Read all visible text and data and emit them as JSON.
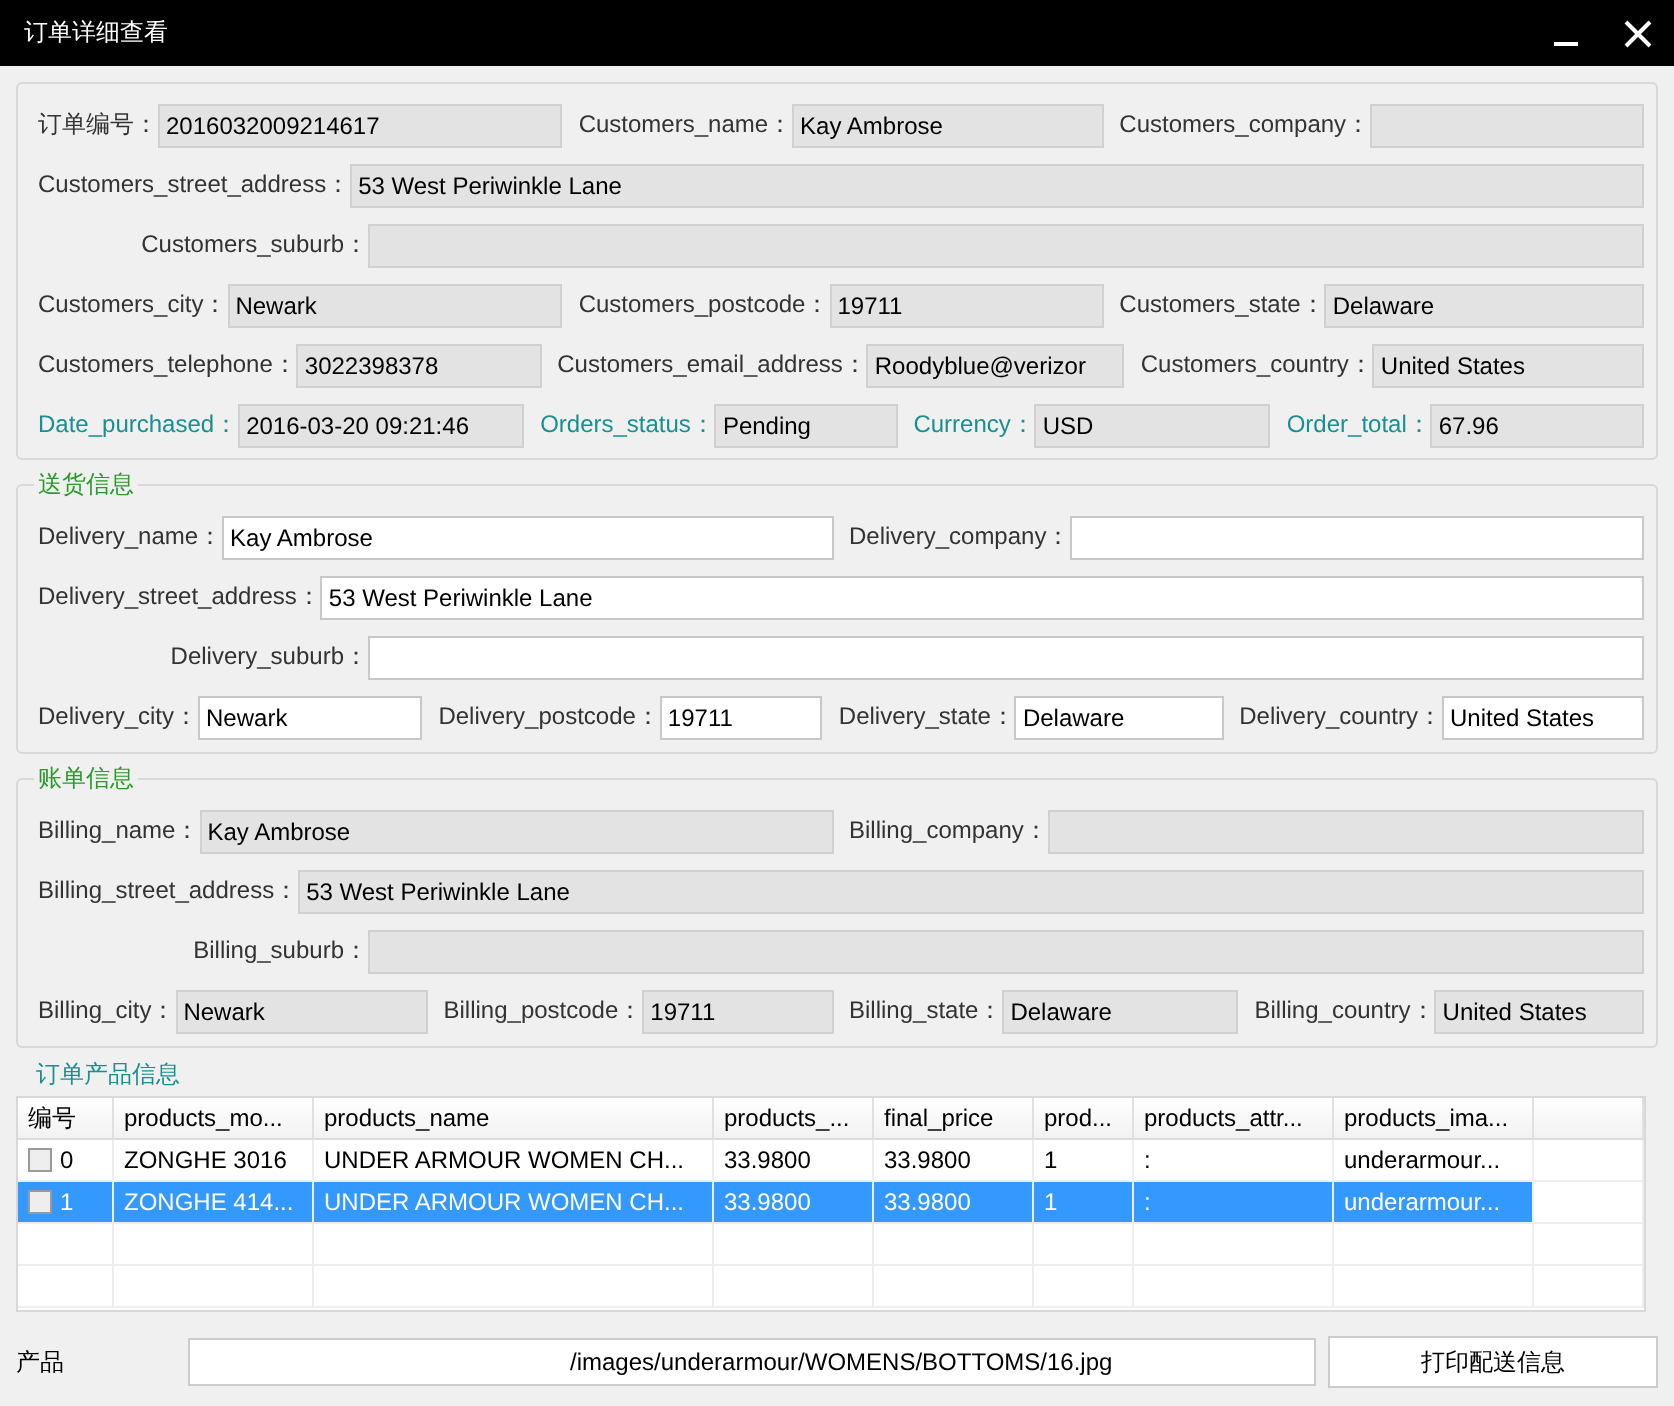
{
  "window": {
    "title": "订单详细查看"
  },
  "groups": [
    {
      "readonly": true,
      "rows": [
        {
          "fields": [
            {
              "label": "订单编号：",
              "value": "2016032009214617",
              "highlight": false
            },
            {
              "label": "Customers_name：",
              "value": "Kay Ambrose",
              "highlight": false
            },
            {
              "label": "Customers_company：",
              "highlight": false
            }
          ]
        },
        {
          "fields": [
            {
              "label": "Customers_street_address：",
              "value": "53 West Periwinkle Lane",
              "highlight": false
            }
          ]
        },
        {
          "fields": [
            {
              "label": "Customers_suburb：",
              "highlight": false
            }
          ]
        },
        {
          "fields": [
            {
              "label": "Customers_city：",
              "value": "Newark",
              "highlight": false
            },
            {
              "label": "Customers_postcode：",
              "value": "19711",
              "highlight": false
            },
            {
              "label": "Customers_state：",
              "value": "Delaware",
              "highlight": false
            }
          ]
        },
        {
          "fields": [
            {
              "label": "Customers_telephone：",
              "value": "3022398378",
              "highlight": false
            },
            {
              "label": "Customers_email_address：",
              "value": "Roodyblue@verizor",
              "highlight": false
            },
            {
              "label": "Customers_country：",
              "value": "United States",
              "highlight": false
            }
          ]
        },
        {
          "fields": [
            {
              "label": "Date_purchased：",
              "value": "2016-03-20 09:21:46",
              "highlight": true
            },
            {
              "label": "Orders_status：",
              "value": "Pending",
              "highlight": true
            },
            {
              "label": "Currency：",
              "value": "USD",
              "highlight": true
            },
            {
              "label": "Order_total：",
              "value": "67.96",
              "highlight": true
            }
          ]
        }
      ]
    },
    {
      "title": "送货信息",
      "readonly": false,
      "rows": [
        {
          "fields": [
            {
              "label": "Delivery_name：",
              "value": "Kay Ambrose",
              "highlight": false
            },
            {
              "label": "Delivery_company：",
              "highlight": false
            }
          ]
        },
        {
          "fields": [
            {
              "label": "Delivery_street_address：",
              "value": "53 West Periwinkle Lane",
              "highlight": false
            }
          ]
        },
        {
          "fields": [
            {
              "label": "Delivery_suburb：",
              "highlight": false
            }
          ]
        },
        {
          "fields": [
            {
              "label": "Delivery_city：",
              "value": "Newark",
              "highlight": false
            },
            {
              "label": "Delivery_postcode：",
              "value": "19711",
              "highlight": false
            },
            {
              "label": "Delivery_state：",
              "value": "Delaware",
              "highlight": false
            },
            {
              "label": "Delivery_country：",
              "value": "United States",
              "highlight": false
            }
          ]
        }
      ]
    },
    {
      "title": "账单信息",
      "readonly": true,
      "rows": [
        {
          "fields": [
            {
              "label": "Billing_name：",
              "value": "Kay Ambrose",
              "highlight": false
            },
            {
              "label": "Billing_company：",
              "highlight": false
            }
          ]
        },
        {
          "fields": [
            {
              "label": "Billing_street_address：",
              "value": "53 West Periwinkle Lane",
              "highlight": false
            }
          ]
        },
        {
          "fields": [
            {
              "label": "Billing_suburb：",
              "highlight": false
            }
          ]
        },
        {
          "fields": [
            {
              "label": "Billing_city：",
              "value": "Newark",
              "highlight": false
            },
            {
              "label": "Billing_postcode：",
              "value": "19711",
              "highlight": false
            },
            {
              "label": "Billing_state：",
              "value": "Delaware",
              "highlight": false
            },
            {
              "label": "Billing_country：",
              "value": "United States",
              "highlight": false
            }
          ]
        }
      ]
    }
  ],
  "products": {
    "title": "订单产品信息",
    "columns": [
      "编号",
      "products_mo...",
      "products_name",
      "products_...",
      "final_price",
      "prod...",
      "products_attr...",
      "products_ima..."
    ],
    "rows": [
      {
        "checked": false,
        "selected": false,
        "cells": [
          "0",
          "ZONGHE 3016",
          "UNDER ARMOUR WOMEN CH...",
          "33.9800",
          "33.9800",
          "1",
          ":",
          "underarmour..."
        ]
      },
      {
        "checked": false,
        "selected": true,
        "cells": [
          "1",
          "ZONGHE 414...",
          "UNDER ARMOUR WOMEN CH...",
          "33.9800",
          "33.9800",
          "1",
          ":",
          "underarmour..."
        ]
      }
    ]
  },
  "image_path": {
    "label": "产品",
    "value": "/images/underarmour/WOMENS/BOTTOMS/16.jpg"
  },
  "print_button": "打印配送信息"
}
